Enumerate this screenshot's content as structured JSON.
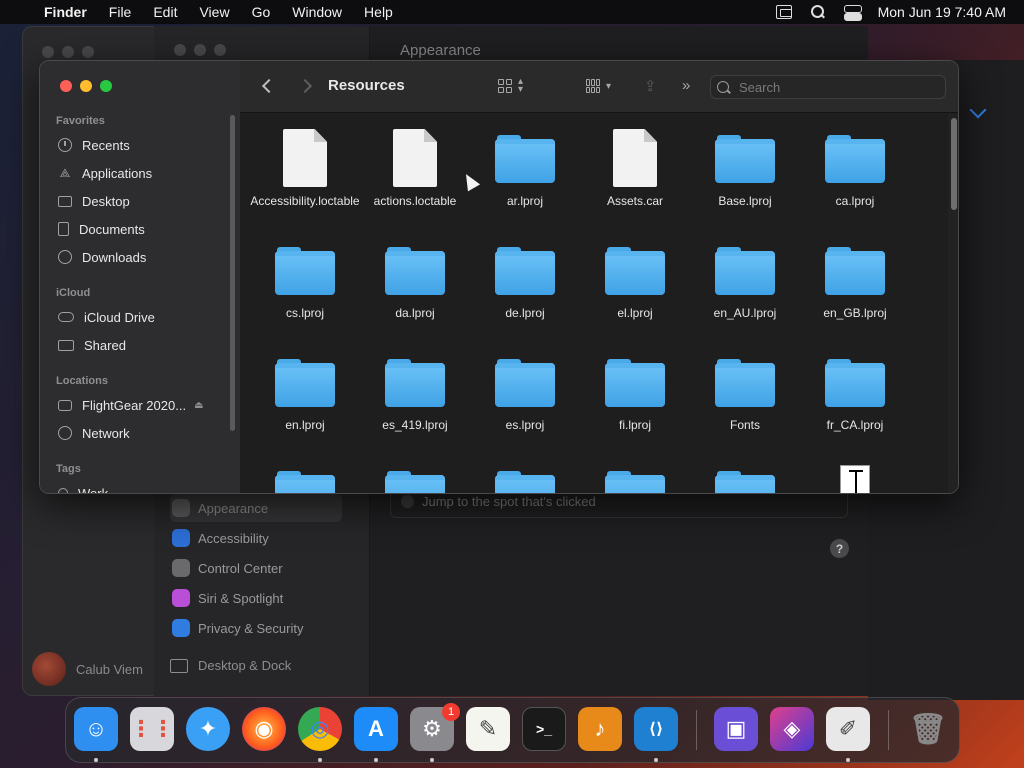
{
  "menubar": {
    "app": "Finder",
    "items": [
      "File",
      "Edit",
      "View",
      "Go",
      "Window",
      "Help"
    ],
    "clock": "Mon Jun 19  7:40 AM"
  },
  "settings_bg": {
    "title": "Appearance",
    "items": [
      {
        "label": "Appearance",
        "color": "#5a5a5c",
        "selected": true
      },
      {
        "label": "Accessibility",
        "color": "#2c6fd6"
      },
      {
        "label": "Control Center",
        "color": "#6a6a6c"
      },
      {
        "label": "Siri & Spotlight",
        "color": "#b84fd6"
      },
      {
        "label": "Privacy & Security",
        "color": "#2f7de1"
      }
    ],
    "jump_label": "Jump to the spot that's clicked",
    "help": "?",
    "user_name": "Calub Viem",
    "desktop_dock": "Desktop & Dock"
  },
  "finder": {
    "title": "Resources",
    "search_placeholder": "Search",
    "sidebar": {
      "favorites_header": "Favorites",
      "favorites": [
        {
          "label": "Recents",
          "icon": "clock-icon"
        },
        {
          "label": "Applications",
          "icon": "applications-icon"
        },
        {
          "label": "Desktop",
          "icon": "desktop-icon"
        },
        {
          "label": "Documents",
          "icon": "document-icon"
        },
        {
          "label": "Downloads",
          "icon": "download-icon"
        }
      ],
      "icloud_header": "iCloud",
      "icloud": [
        {
          "label": "iCloud Drive",
          "icon": "cloud-icon"
        },
        {
          "label": "Shared",
          "icon": "shared-folder-icon"
        }
      ],
      "locations_header": "Locations",
      "locations": [
        {
          "label": "FlightGear 2020...",
          "icon": "drive-icon"
        },
        {
          "label": "Network",
          "icon": "globe-icon"
        }
      ],
      "tags_header": "Tags",
      "tags": [
        {
          "label": "Work",
          "icon": "tag-icon"
        }
      ]
    },
    "files": [
      {
        "name": "Accessibility.loctable",
        "kind": "file"
      },
      {
        "name": "actions.loctable",
        "kind": "file"
      },
      {
        "name": "ar.lproj",
        "kind": "folder"
      },
      {
        "name": "Assets.car",
        "kind": "file"
      },
      {
        "name": "Base.lproj",
        "kind": "folder"
      },
      {
        "name": "ca.lproj",
        "kind": "folder"
      },
      {
        "name": "cs.lproj",
        "kind": "folder"
      },
      {
        "name": "da.lproj",
        "kind": "folder"
      },
      {
        "name": "de.lproj",
        "kind": "folder"
      },
      {
        "name": "el.lproj",
        "kind": "folder"
      },
      {
        "name": "en_AU.lproj",
        "kind": "folder"
      },
      {
        "name": "en_GB.lproj",
        "kind": "folder"
      },
      {
        "name": "en.lproj",
        "kind": "folder"
      },
      {
        "name": "es_419.lproj",
        "kind": "folder"
      },
      {
        "name": "es.lproj",
        "kind": "folder"
      },
      {
        "name": "fi.lproj",
        "kind": "folder"
      },
      {
        "name": "Fonts",
        "kind": "folder"
      },
      {
        "name": "fr_CA.lproj",
        "kind": "folder"
      }
    ]
  },
  "dock": {
    "apps": [
      {
        "name": "finder-app",
        "color": "#2f8ff0",
        "glyph": "☺"
      },
      {
        "name": "launchpad-app",
        "color": "#d8d8dc",
        "glyph": "⋮⋮"
      },
      {
        "name": "safari-app",
        "color": "#3aa0f5",
        "glyph": "✦"
      },
      {
        "name": "firefox-app",
        "color": "#ff7a1a",
        "glyph": "◉"
      },
      {
        "name": "chrome-app",
        "color": "#f2f2f2",
        "glyph": "◎"
      },
      {
        "name": "app-store-app",
        "color": "#1d8cf8",
        "glyph": "A"
      },
      {
        "name": "system-settings-app",
        "color": "#8a8a8e",
        "glyph": "⚙",
        "badge": "1"
      },
      {
        "name": "textedit-app",
        "color": "#f5f5f0",
        "glyph": "✎"
      },
      {
        "name": "terminal-app",
        "color": "#1a1a1a",
        "glyph": ">_"
      },
      {
        "name": "garageband-app",
        "color": "#e88a1a",
        "glyph": "♪"
      },
      {
        "name": "vscode-app",
        "color": "#1f7fd1",
        "glyph": "⟨⟩"
      },
      {
        "name": "apple-configurator-app",
        "color": "#6a4fd6",
        "glyph": "▣"
      },
      {
        "name": "shortcuts-app",
        "color": "#4a3ad6",
        "glyph": "◈"
      },
      {
        "name": "script-editor-app",
        "color": "#e8e8e8",
        "glyph": "✐"
      },
      {
        "name": "trash-app",
        "color": "#6a6a6e",
        "glyph": "🗑"
      }
    ]
  }
}
